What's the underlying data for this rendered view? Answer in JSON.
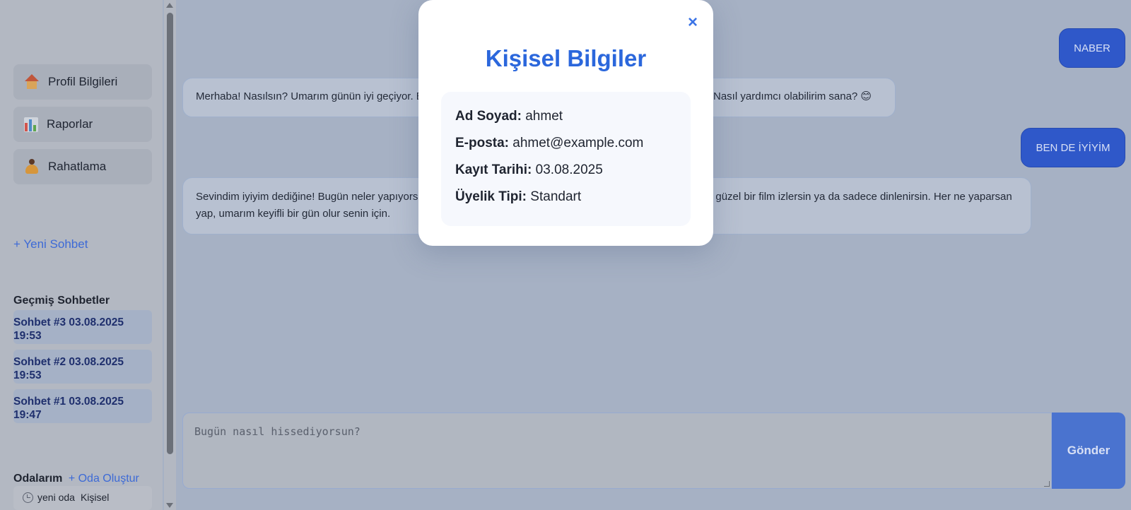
{
  "sidebar": {
    "nav": [
      {
        "label": "Profil Bilgileri",
        "icon": "house-icon"
      },
      {
        "label": "Raporlar",
        "icon": "bar-chart-icon"
      },
      {
        "label": "Rahatlama",
        "icon": "meditation-icon"
      }
    ],
    "new_chat": "+ Yeni Sohbet",
    "history_title": "Geçmiş Sohbetler",
    "history": [
      {
        "line1": "Sohbet #3 03.08.2025",
        "line2": "19:53"
      },
      {
        "line1": "Sohbet #2 03.08.2025",
        "line2": "19:53"
      },
      {
        "line1": "Sohbet #1 03.08.2025",
        "line2": "19:47"
      }
    ],
    "rooms_title": "Odalarım",
    "rooms_create": "+ Oda Oluştur",
    "room": {
      "name": "yeni oda",
      "type": "Kişisel"
    }
  },
  "chat": {
    "messages": [
      {
        "role": "user",
        "text": "NABER"
      },
      {
        "role": "bot",
        "text": "Merhaba! Nasılsın? Umarım günün iyi geçiyor. Bugün neler yapmak istersin? Ben buradayım, seni dinliyorum. Nasıl yardımcı olabilirim sana? 😊"
      },
      {
        "role": "user",
        "text": "BEN DE İYİYİM"
      },
      {
        "role": "bot",
        "text": "Sevindim iyiyim dediğine! Bugün neler yapıyorsun? Belki dışarı çıkıp biraz yürüyüş yaparsın, bir kitap okursun, güzel bir film izlersin ya da sadece dinlenirsin. Her ne yaparsan yap, umarım keyifli bir gün olur senin için."
      }
    ],
    "input_placeholder": "Bugün nasıl hissediyorsun?",
    "send_label": "Gönder"
  },
  "modal": {
    "close_symbol": "×",
    "title": "Kişisel Bilgiler",
    "fields": [
      {
        "label": "Ad Soyad:",
        "value": "ahmet"
      },
      {
        "label": "E-posta:",
        "value": "ahmet@example.com"
      },
      {
        "label": "Kayıt Tarihi:",
        "value": "03.08.2025"
      },
      {
        "label": "Üyelik Tipi:",
        "value": "Standart"
      }
    ]
  },
  "colors": {
    "accent": "#2b67dc",
    "user_bubble": "#2f58c9",
    "overlay_bg": "#a6b1c4"
  }
}
